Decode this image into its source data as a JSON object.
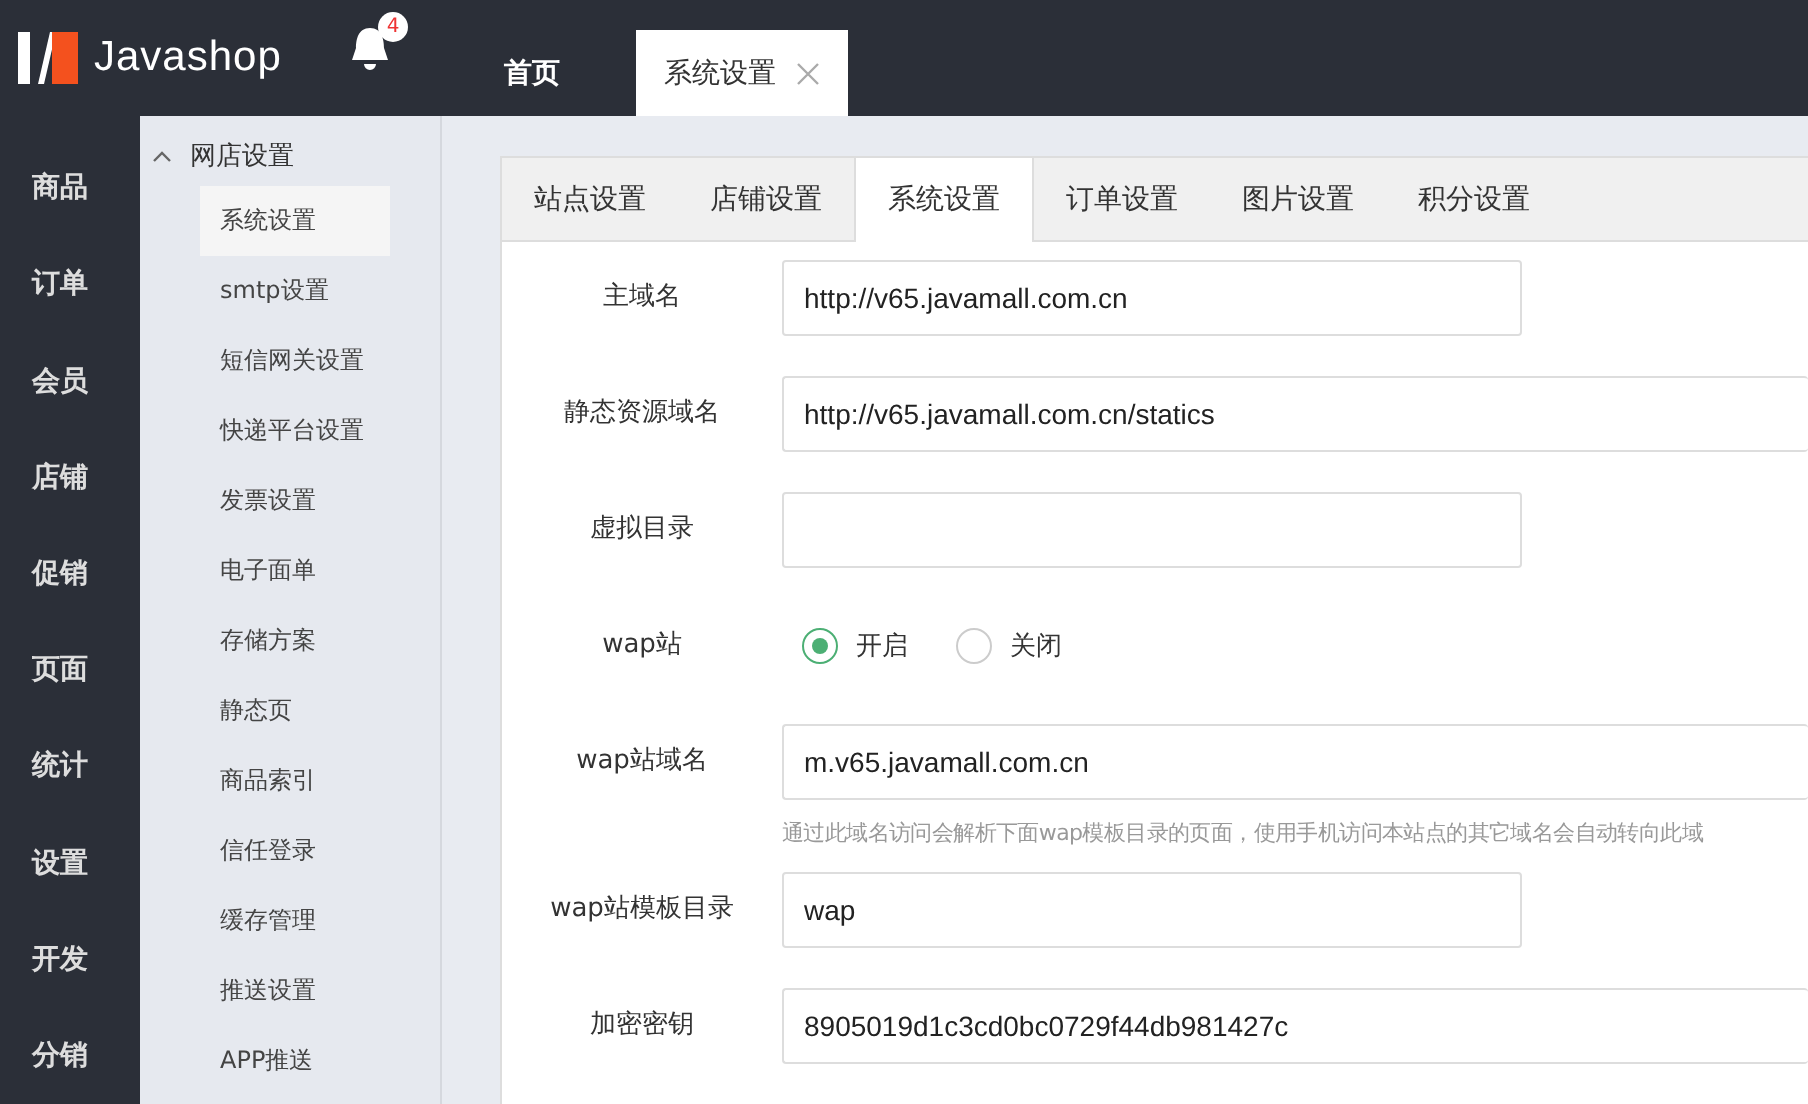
{
  "header": {
    "logo": "Javashop",
    "notifications": {
      "count": "4"
    },
    "tabs": [
      {
        "label": "首页",
        "selected": false,
        "closable": false
      },
      {
        "label": "系统设置",
        "selected": true,
        "closable": true
      }
    ]
  },
  "nav": {
    "items": [
      {
        "label": "商品",
        "selected": false
      },
      {
        "label": "订单",
        "selected": false
      },
      {
        "label": "会员",
        "selected": false
      },
      {
        "label": "店铺",
        "selected": false
      },
      {
        "label": "促销",
        "selected": false
      },
      {
        "label": "页面",
        "selected": false
      },
      {
        "label": "统计",
        "selected": false
      },
      {
        "label": "设置",
        "selected": false
      },
      {
        "label": "开发",
        "selected": false
      },
      {
        "label": "分销",
        "selected": false
      }
    ]
  },
  "submenu": {
    "group": "网店设置",
    "expanded": true,
    "items": [
      {
        "label": "系统设置",
        "selected": true
      },
      {
        "label": "smtp设置",
        "selected": false
      },
      {
        "label": "短信网关设置",
        "selected": false
      },
      {
        "label": "快递平台设置",
        "selected": false
      },
      {
        "label": "发票设置",
        "selected": false
      },
      {
        "label": "电子面单",
        "selected": false
      },
      {
        "label": "存储方案",
        "selected": false
      },
      {
        "label": "静态页",
        "selected": false
      },
      {
        "label": "商品索引",
        "selected": false
      },
      {
        "label": "信任登录",
        "selected": false
      },
      {
        "label": "缓存管理",
        "selected": false
      },
      {
        "label": "推送设置",
        "selected": false
      },
      {
        "label": "APP推送",
        "selected": false
      }
    ]
  },
  "settings": {
    "tabs": [
      {
        "label": "站点设置",
        "selected": false
      },
      {
        "label": "店铺设置",
        "selected": false
      },
      {
        "label": "系统设置",
        "selected": true
      },
      {
        "label": "订单设置",
        "selected": false
      },
      {
        "label": "图片设置",
        "selected": false
      },
      {
        "label": "积分设置",
        "selected": false
      }
    ],
    "rows": [
      {
        "kind": "input",
        "label": "主域名",
        "value": "http://v65.javamall.com.cn",
        "wide": false
      },
      {
        "kind": "input",
        "label": "静态资源域名",
        "value": "http://v65.javamall.com.cn/statics",
        "wide": true
      },
      {
        "kind": "input",
        "label": "虚拟目录",
        "wide": false
      },
      {
        "kind": "radio",
        "label": "wap站",
        "options": [
          {
            "label": "开启",
            "selected": true
          },
          {
            "label": "关闭",
            "selected": false
          }
        ]
      },
      {
        "kind": "input",
        "label": "wap站域名",
        "value": "m.v65.javamall.com.cn",
        "wide": true,
        "hint": "通过此域名访问会解析下面wap模板目录的页面，使用手机访问本站点的其它域名会自动转向此域"
      },
      {
        "kind": "input",
        "label": "wap站模板目录",
        "value": "wap",
        "wide": false
      },
      {
        "kind": "input",
        "label": "加密密钥",
        "value": "8905019d1c3cd0bc0729f44db981427c",
        "wide": true
      }
    ]
  }
}
